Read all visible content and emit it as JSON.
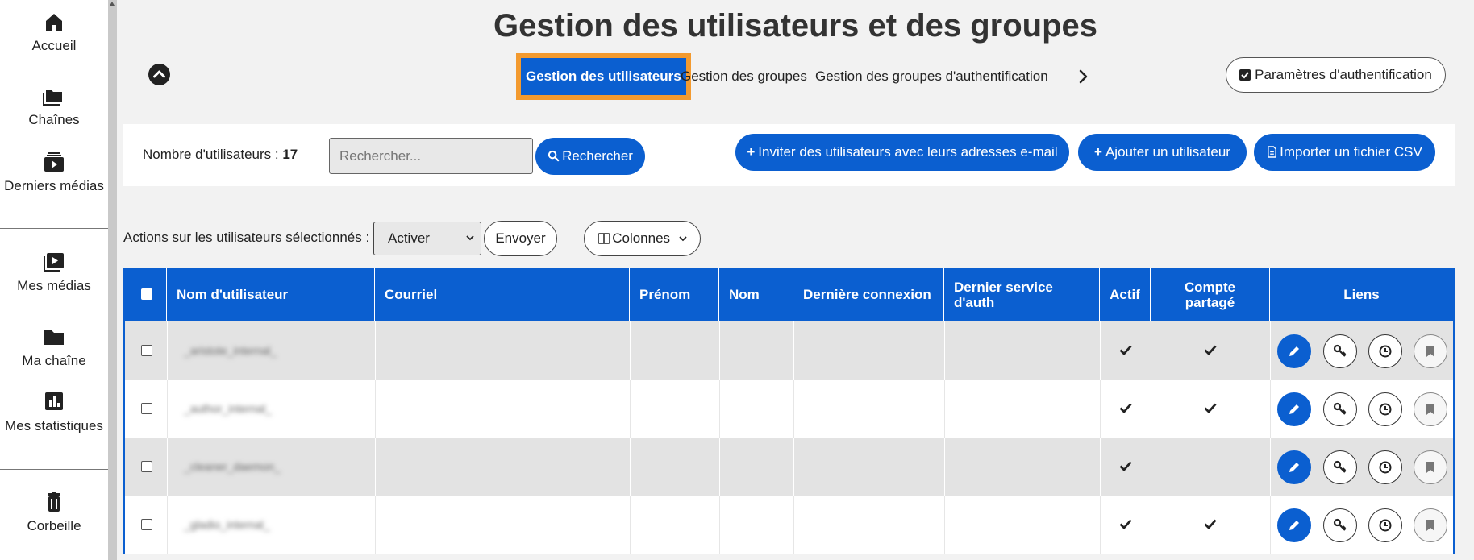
{
  "sidebar": {
    "items": [
      {
        "label": "Accueil",
        "icon": "home-icon"
      },
      {
        "label": "Chaînes",
        "icon": "folders-icon"
      },
      {
        "label": "Derniers médias",
        "icon": "latest-media-icon"
      },
      {
        "label": "Mes médias",
        "icon": "my-media-icon"
      },
      {
        "label": "Ma chaîne",
        "icon": "folder-icon"
      },
      {
        "label": "Mes statistiques",
        "icon": "stats-icon"
      },
      {
        "label": "Corbeille",
        "icon": "trash-icon"
      }
    ]
  },
  "page": {
    "title": "Gestion des utilisateurs et des groupes"
  },
  "tabs": [
    {
      "label": "Gestion des utilisateurs",
      "active": true
    },
    {
      "label": "Gestion des groupes",
      "active": false
    },
    {
      "label": "Gestion des groupes d'authentification",
      "active": false
    }
  ],
  "auth_params_label": "Paramètres d'authentification",
  "toolbar": {
    "count_label": "Nombre d'utilisateurs :",
    "count_value": "17",
    "search_placeholder": "Rechercher...",
    "search_button": "Rechercher",
    "invite_button": "Inviter des utilisateurs avec leurs adresses e-mail",
    "add_button": "Ajouter un utilisateur",
    "import_button": "Importer un fichier CSV"
  },
  "bulk": {
    "label": "Actions sur les utilisateurs sélectionnés :",
    "selected_action": "Activer",
    "send_button": "Envoyer",
    "columns_button": "Colonnes"
  },
  "table": {
    "headers": [
      "Nom d'utilisateur",
      "Courriel",
      "Prénom",
      "Nom",
      "Dernière connexion",
      "Dernier service d'auth",
      "Actif",
      "Compte partagé",
      "Liens"
    ],
    "rows": [
      {
        "username": "_aristote_internal_",
        "actif": true,
        "partage": true
      },
      {
        "username": "_author_internal_",
        "actif": true,
        "partage": true
      },
      {
        "username": "_cleaner_daemon_",
        "actif": true,
        "partage": false
      },
      {
        "username": "_gladio_internal_",
        "actif": true,
        "partage": true
      }
    ]
  },
  "colors": {
    "primary": "#0b5fd0",
    "highlight": "#f39a2f",
    "row_alt": "#e3e3e3"
  }
}
